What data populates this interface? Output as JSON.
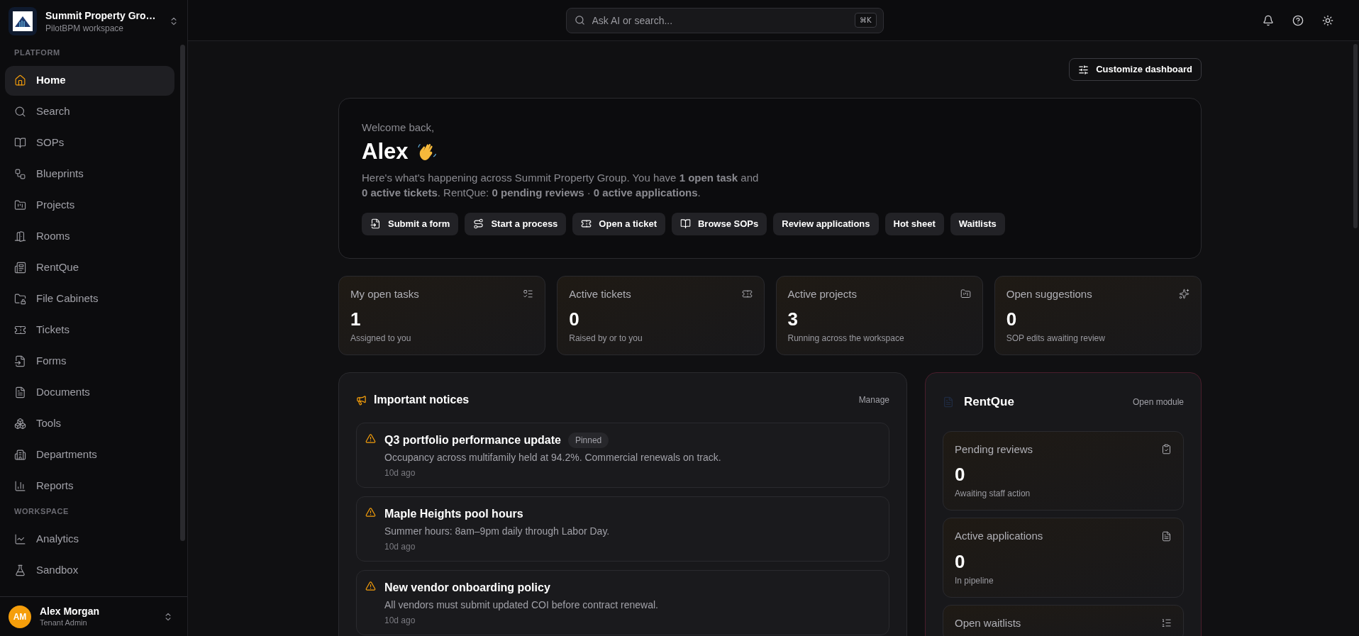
{
  "workspace": {
    "name": "Summit Property Gro…",
    "subtitle": "PilotBPM workspace"
  },
  "sidebar": {
    "sections": [
      {
        "title": "PLATFORM",
        "items": [
          {
            "label": "Home",
            "selected": true
          },
          {
            "label": "Search",
            "selected": false
          },
          {
            "label": "SOPs",
            "selected": false
          },
          {
            "label": "Blueprints",
            "selected": false
          },
          {
            "label": "Projects",
            "selected": false
          },
          {
            "label": "Rooms",
            "selected": false
          },
          {
            "label": "RentQue",
            "selected": false
          },
          {
            "label": "File Cabinets",
            "selected": false
          },
          {
            "label": "Tickets",
            "selected": false
          },
          {
            "label": "Forms",
            "selected": false
          },
          {
            "label": "Documents",
            "selected": false
          },
          {
            "label": "Tools",
            "selected": false
          },
          {
            "label": "Departments",
            "selected": false
          },
          {
            "label": "Reports",
            "selected": false
          }
        ]
      },
      {
        "title": "WORKSPACE",
        "items": [
          {
            "label": "Analytics",
            "selected": false
          },
          {
            "label": "Sandbox",
            "selected": false
          }
        ]
      }
    ]
  },
  "user": {
    "initials": "AM",
    "name": "Alex Morgan",
    "role": "Tenant Admin"
  },
  "search": {
    "placeholder": "Ask AI or search...",
    "shortcut": "⌘K"
  },
  "customize_button": "Customize dashboard",
  "welcome": {
    "greeting": "Welcome back,",
    "name": "Alex",
    "message": "Here's what's happening across Summit Property Group. You have **1 open task** and **0 active tickets**. RentQue: **0 pending reviews** · **0 active applications**.",
    "actions": [
      "Submit a form",
      "Start a process",
      "Open a ticket",
      "Browse SOPs",
      "Review applications",
      "Hot sheet",
      "Waitlists"
    ]
  },
  "stats": [
    {
      "title": "My open tasks",
      "value": "1",
      "caption": "Assigned to you"
    },
    {
      "title": "Active tickets",
      "value": "0",
      "caption": "Raised by or to you"
    },
    {
      "title": "Active projects",
      "value": "3",
      "caption": "Running across the workspace"
    },
    {
      "title": "Open suggestions",
      "value": "0",
      "caption": "SOP edits awaiting review"
    }
  ],
  "notices": {
    "title": "Important notices",
    "action": "Manage",
    "items": [
      {
        "title": "Q3 portfolio performance update",
        "badge": "Pinned",
        "body": "Occupancy across multifamily held at 94.2%. Commercial renewals on track.",
        "time": "10d ago"
      },
      {
        "title": "Maple Heights pool hours",
        "body": "Summer hours: 8am–9pm daily through Labor Day.",
        "time": "10d ago"
      },
      {
        "title": "New vendor onboarding policy",
        "body": "All vendors must submit updated COI before contract renewal.",
        "time": "10d ago"
      }
    ]
  },
  "rentque": {
    "title": "RentQue",
    "action": "Open module",
    "cards": [
      {
        "title": "Pending reviews",
        "value": "0",
        "caption": "Awaiting staff action"
      },
      {
        "title": "Active applications",
        "value": "0",
        "caption": "In pipeline"
      },
      {
        "title": "Open waitlists"
      }
    ]
  }
}
